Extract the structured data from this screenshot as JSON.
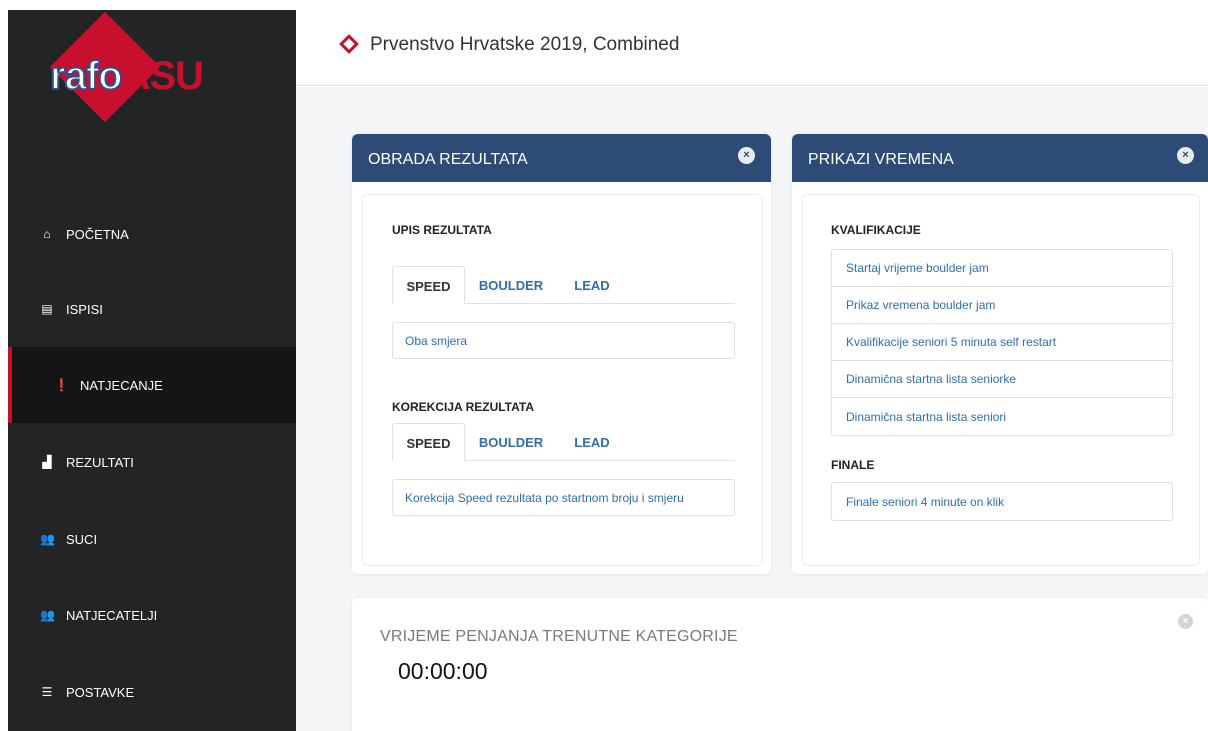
{
  "sidebar": {
    "logo": {
      "part1": "rafo",
      "part2": "ASU"
    },
    "items": [
      {
        "label": "POČETNA",
        "icon": "home-icon",
        "glyph": "⌂"
      },
      {
        "label": "ISPISI",
        "icon": "database-icon",
        "glyph": "▤"
      },
      {
        "label": "NATJECANJE",
        "icon": "exclamation-icon",
        "glyph": "❗"
      },
      {
        "label": "REZULTATI",
        "icon": "bar-chart-icon",
        "glyph": "▟"
      },
      {
        "label": "SUCI",
        "icon": "users-icon",
        "glyph": "👥"
      },
      {
        "label": "NATJECATELJI",
        "icon": "users-icon",
        "glyph": "👥"
      },
      {
        "label": "POSTAVKE",
        "icon": "sliders-icon",
        "glyph": "☰"
      }
    ],
    "active_index": 2
  },
  "header": {
    "title": "Prvenstvo Hrvatske 2019, Combined",
    "icon": "diamond-icon"
  },
  "obrada": {
    "title": "OBRADA REZULTATA",
    "upis": {
      "title": "UPIS REZULTATA",
      "tabs": [
        "SPEED",
        "BOULDER",
        "LEAD"
      ],
      "active_tab": "SPEED",
      "link": "Oba smjera"
    },
    "korekcija": {
      "title": "KOREKCIJA REZULTATA",
      "tabs": [
        "SPEED",
        "BOULDER",
        "LEAD"
      ],
      "active_tab": "SPEED",
      "link": "Korekcija Speed rezultata po startnom broju i smjeru"
    }
  },
  "prikazi": {
    "title": "PRIKAZI VREMENA",
    "kvalifikacije": {
      "title": "KVALIFIKACIJE",
      "items": [
        "Startaj vrijeme boulder jam",
        "Prikaz vremena boulder jam",
        "Kvalifikacije seniori 5 minuta self restart",
        "Dinamična startna lista seniorke",
        "Dinamična startna lista seniori"
      ]
    },
    "finale": {
      "title": "FINALE",
      "items": [
        "Finale seniori 4 minute on klik"
      ]
    }
  },
  "timer": {
    "title": "VRIJEME PENJANJA TRENUTNE KATEGORIJE",
    "value": "00:00:00"
  },
  "colors": {
    "accent": "#c8102e",
    "panel_header": "#2e4a77",
    "sidebar": "#222426",
    "link": "#2f6fb0"
  }
}
